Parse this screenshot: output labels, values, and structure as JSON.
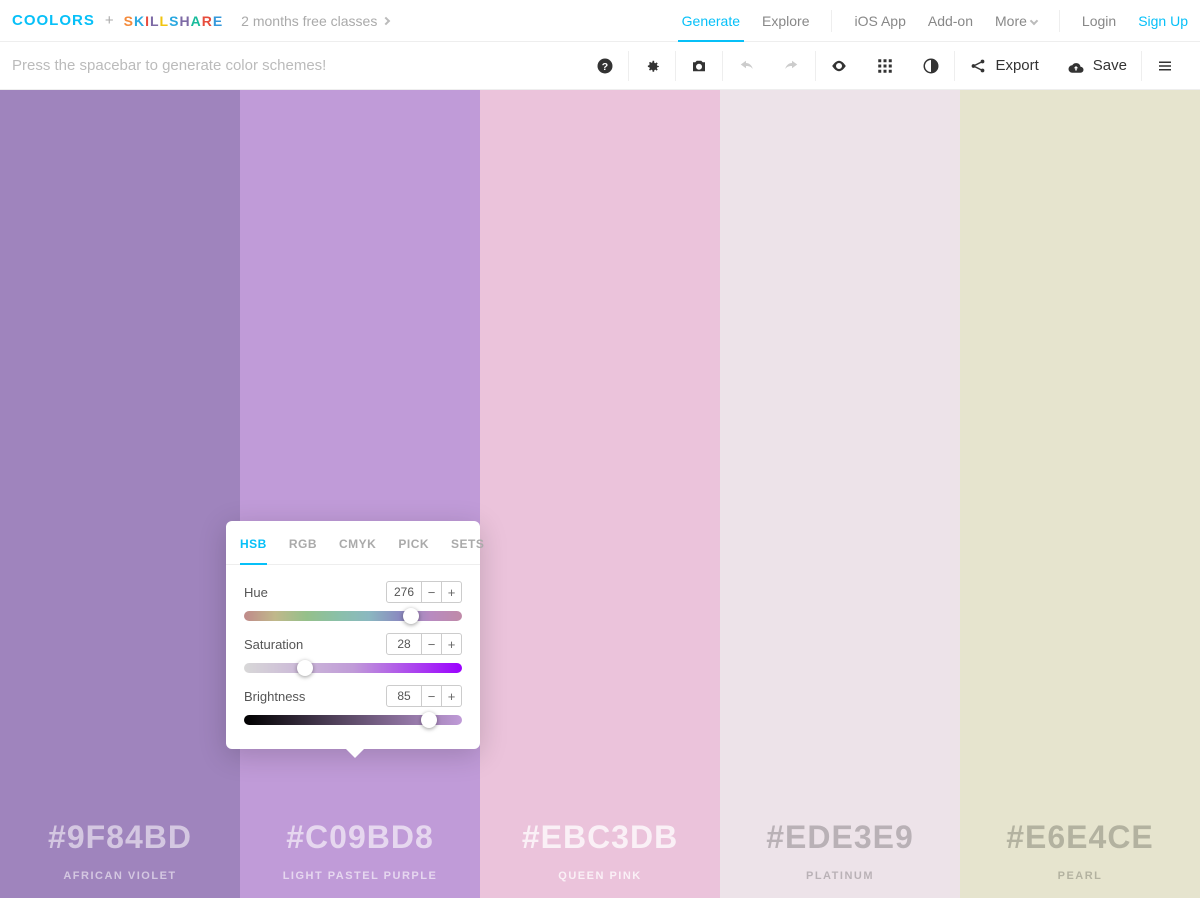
{
  "header": {
    "logo_text": "COOLORS",
    "partner_text": "SKILLSHARE",
    "promo_text": "2 months free classes",
    "nav": {
      "generate": "Generate",
      "explore": "Explore",
      "ios": "iOS App",
      "addon": "Add-on",
      "more": "More",
      "login": "Login",
      "signup": "Sign Up"
    }
  },
  "toolbar": {
    "hint": "Press the spacebar to generate color schemes!",
    "export": "Export",
    "save": "Save"
  },
  "palette": [
    {
      "hex": "#9F84BD",
      "name": "AFRICAN VIOLET",
      "bg": "#9F84BD",
      "text_rgba": "rgba(255,255,255,0.55)"
    },
    {
      "hex": "#C09BD8",
      "name": "LIGHT PASTEL PURPLE",
      "bg": "#C09BD8",
      "text_rgba": "rgba(255,255,255,0.6)"
    },
    {
      "hex": "#EBC3DB",
      "name": "QUEEN PINK",
      "bg": "#EBC3DB",
      "text_rgba": "rgba(255,255,255,0.75)"
    },
    {
      "hex": "#EDE3E9",
      "name": "PLATINUM",
      "bg": "#EDE3E9",
      "text_rgba": "rgba(0,0,0,0.22)"
    },
    {
      "hex": "#E6E4CE",
      "name": "PEARL",
      "bg": "#E6E4CE",
      "text_rgba": "rgba(0,0,0,0.22)"
    }
  ],
  "picker": {
    "tabs": {
      "hsb": "HSB",
      "rgb": "RGB",
      "cmyk": "CMYK",
      "pick": "PICK",
      "sets": "SETS"
    },
    "active_tab": "hsb",
    "hue": {
      "label": "Hue",
      "value": "276",
      "thumb_pct": 76.6
    },
    "saturation": {
      "label": "Saturation",
      "value": "28",
      "thumb_pct": 28
    },
    "brightness": {
      "label": "Brightness",
      "value": "85",
      "thumb_pct": 85
    }
  }
}
